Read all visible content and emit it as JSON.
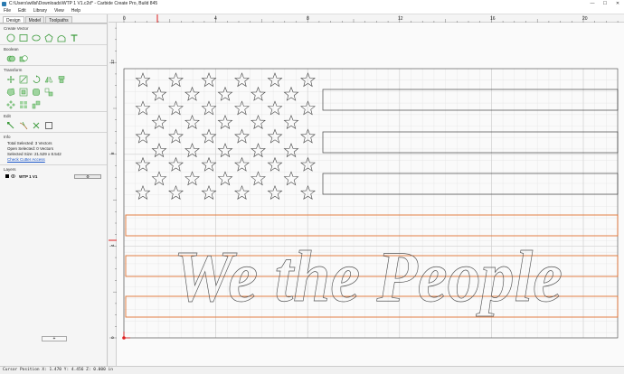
{
  "window": {
    "title": "C:\\Users\\willsl\\Downloads\\WTP 1 V1.c2d* - Carbide Create Pro, Build 845",
    "controls": [
      "—",
      "☐",
      "✕"
    ]
  },
  "menu": [
    "File",
    "Edit",
    "Library",
    "View",
    "Help"
  ],
  "sidebar": {
    "tabs": [
      "Design",
      "Model",
      "Toolpaths"
    ],
    "sections": {
      "create_vector": "Create Vector",
      "boolean": "Boolean",
      "transform": "Transform",
      "edit": "Edit",
      "info": "Info",
      "layers": "Layers"
    },
    "info": {
      "total_selected": "Total Selected:   3 Vectors",
      "open_selected": "Open Selected:   0 Vectors",
      "selected_size": "Selected Size:    21.529 x 8.542",
      "check_link": "Check Cutter Access"
    },
    "layer": {
      "name": "WTP 1 V1",
      "gear": "⚙",
      "add": "+"
    }
  },
  "ruler": {
    "h_labels": [
      "0",
      "4",
      "8",
      "12",
      "16",
      "20"
    ],
    "v_labels": [
      "12",
      "8",
      "4",
      "0"
    ]
  },
  "canvas": {
    "text_art": "We the People",
    "colors": {
      "selection": "#e07030",
      "vector": "#555555",
      "grid": "#e4e4e4",
      "marker": "#e02020",
      "accent": "#3a9a3a"
    }
  },
  "status": {
    "cursor": "Cursor Position X: 1.470 Y: 4.456 Z: 0.000 in"
  }
}
